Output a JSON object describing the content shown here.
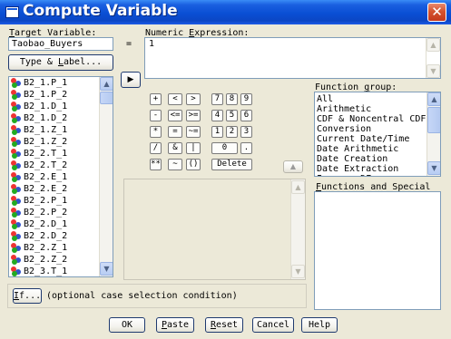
{
  "window": {
    "title": "Compute Variable",
    "close_glyph": "✕"
  },
  "target": {
    "label_pre": "",
    "label_key": "T",
    "label_post": "arget Variable:",
    "value": "Taobao_Buyers",
    "equals": "="
  },
  "expression": {
    "label_pre": "Numeric ",
    "label_key": "E",
    "label_post": "xpression:",
    "value": "1"
  },
  "type_label_button": {
    "label_pre": "Type & ",
    "label_key": "L",
    "label_post": "abel..."
  },
  "move_button": {
    "glyph": "▶"
  },
  "variables": [
    "B2_1.P_1",
    "B2_1.P_2",
    "B2_1.D_1",
    "B2_1.D_2",
    "B2_1.Z_1",
    "B2_1.Z_2",
    "B2_2.T_1",
    "B2_2.T_2",
    "B2_2.E_1",
    "B2_2.E_2",
    "B2_2.P_1",
    "B2_2.P_2",
    "B2_2.D_1",
    "B2_2.D_2",
    "B2_2.Z_1",
    "B2_2.Z_2",
    "B2_3.T_1"
  ],
  "keypad": {
    "r1": [
      "+",
      "<",
      ">",
      "7",
      "8",
      "9"
    ],
    "r2": [
      "-",
      "<=",
      ">=",
      "4",
      "5",
      "6"
    ],
    "r3": [
      "*",
      "=",
      "~=",
      "1",
      "2",
      "3"
    ],
    "r4": [
      "/",
      "&",
      "|",
      "0",
      "."
    ],
    "r5": [
      "**",
      "~",
      "()",
      "Delete"
    ]
  },
  "up_arrow_glyph": "▲",
  "function_group": {
    "label_pre": "Function ",
    "label_key": "g",
    "label_post": "roup:",
    "items": [
      "All",
      "Arithmetic",
      "CDF & Noncentral CDF",
      "Conversion",
      "Current Date/Time",
      "Date Arithmetic",
      "Date Creation",
      "Date Extraction",
      "Inverse DF"
    ]
  },
  "functions_special": {
    "label_pre": "",
    "label_key": "F",
    "label_post": "unctions and Special"
  },
  "if_button": {
    "label_pre": "",
    "label_key": "I",
    "label_post": "f...",
    "note": "(optional case selection condition)"
  },
  "buttons": {
    "ok": {
      "label_pre": "OK",
      "label_key": "",
      "label_post": ""
    },
    "paste": {
      "label_pre": "",
      "label_key": "P",
      "label_post": "aste"
    },
    "reset": {
      "label_pre": "",
      "label_key": "R",
      "label_post": "eset"
    },
    "cancel": {
      "label_pre": "Cancel",
      "label_key": "",
      "label_post": ""
    },
    "help": {
      "label_pre": "Help",
      "label_key": "",
      "label_post": ""
    }
  }
}
